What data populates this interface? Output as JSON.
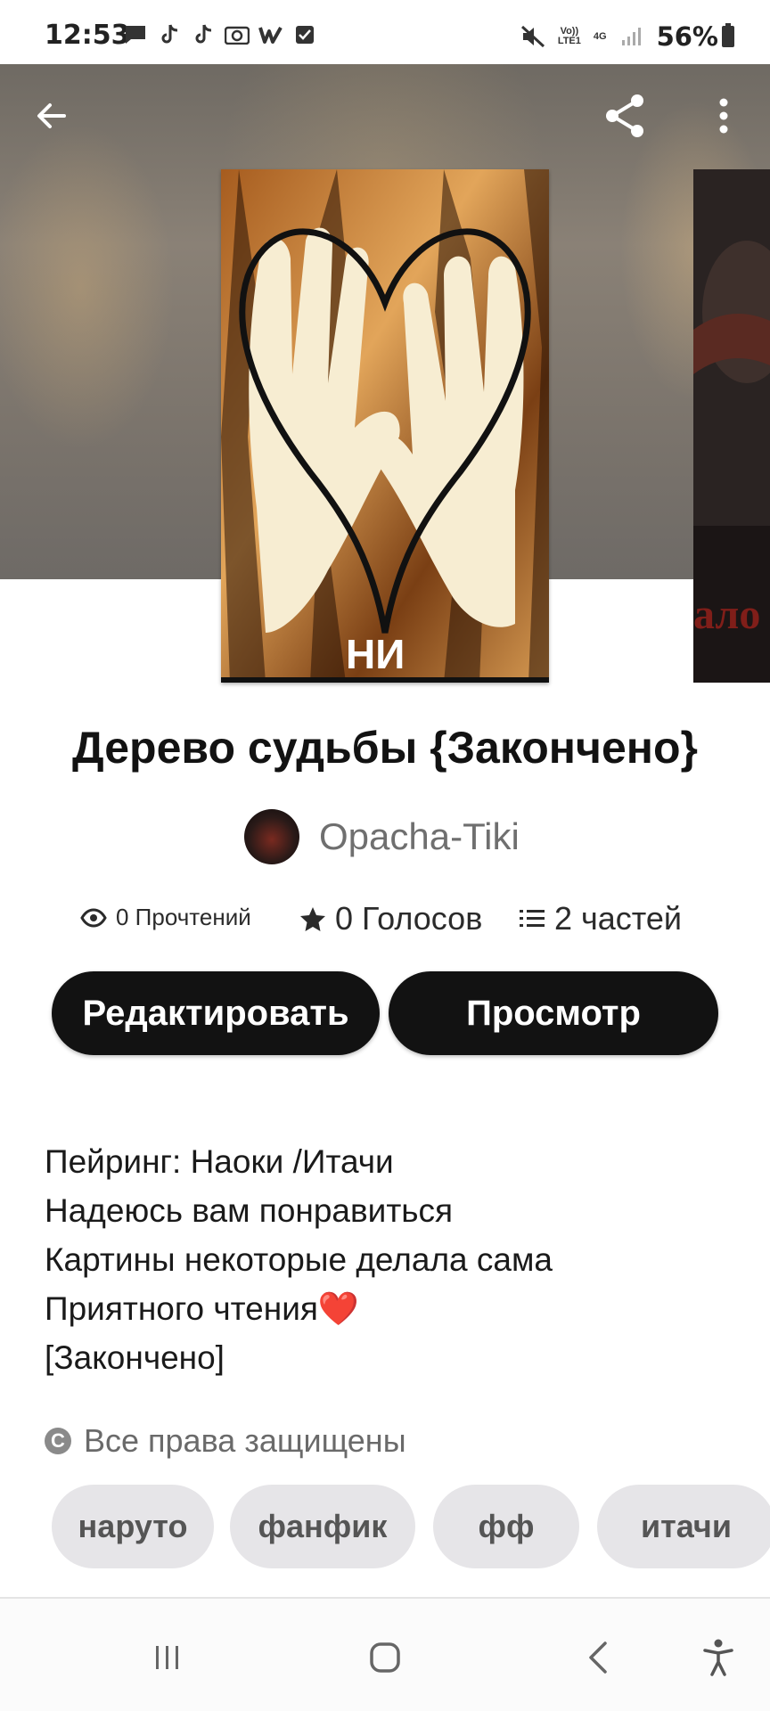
{
  "status_bar": {
    "time": "12:53",
    "left_icons": [
      "message-icon",
      "tiktok-icon",
      "tiktok-icon",
      "instagram-icon",
      "wattpad-icon",
      "checkbox-icon"
    ],
    "volte": "Vo))\nLTE1",
    "network": "4G",
    "battery": "56%"
  },
  "header": {
    "back_icon": "arrow-left-icon",
    "share_icon": "share-icon",
    "more_icon": "more-vertical-icon"
  },
  "cover": {
    "bottom_text": "НИ",
    "next_cover_text": "ало"
  },
  "story": {
    "title": "Дерево судьбы {Закончено}",
    "author": "Opacha-Tiki",
    "stats": {
      "reads": "0 Прочтений",
      "votes": "0 Голосов",
      "parts": "2 частей"
    },
    "buttons": {
      "edit": "Редактировать",
      "view": "Просмотр"
    },
    "description": [
      "Пейринг: Наоки /Итачи",
      "Надеюсь вам понравиться",
      "Картины некоторые делала сама",
      "Приятного чтения",
      "[Закончено]"
    ],
    "heart_emoji": "❤️",
    "copyright": "Все права защищены",
    "tags": [
      "наруто",
      "фанфик",
      "фф",
      "итачи"
    ]
  },
  "colors": {
    "primary_button": "#121212",
    "tag_bg": "#e6e5e8",
    "heart": "#e0282e"
  }
}
